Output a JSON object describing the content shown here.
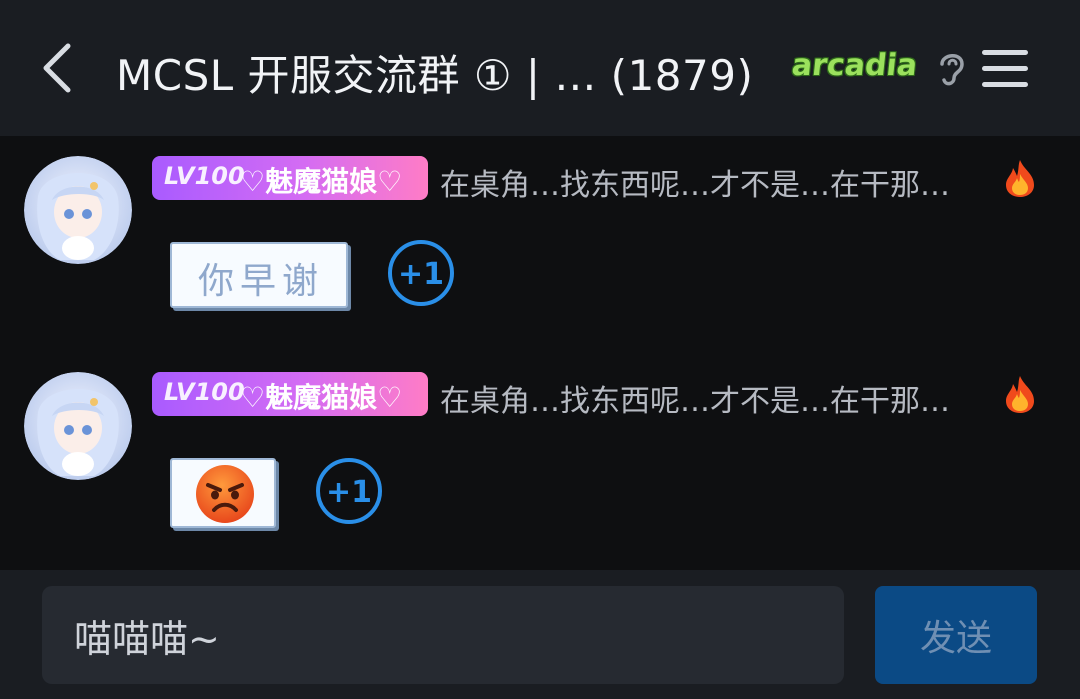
{
  "header": {
    "back_icon": "chevron-left-icon",
    "title": "MCSL 开服交流群 ① | …  (1879)",
    "badge_text": "arcadia",
    "ear_icon": "ear-icon",
    "menu_icon": "hamburger-menu-icon"
  },
  "messages": [
    {
      "level": "LV100",
      "nickname": "♡魅魔猫娘♡",
      "preview": "在桌角…找东西呢…才不是…在干那…",
      "fire_icon": "fire-icon",
      "sticker_text": "你早谢",
      "plus_one": "+1"
    },
    {
      "level": "LV100",
      "nickname": "♡魅魔猫娘♡",
      "preview": "在桌角…找东西呢…才不是…在干那…",
      "fire_icon": "fire-icon",
      "sticker_emoji": "angry-face-emoji",
      "plus_one": "+1"
    }
  ],
  "composer": {
    "input_value": "喵喵喵~",
    "send_label": "发送"
  },
  "colors": {
    "header_bg": "#1a1d22",
    "chat_bg": "#0e0f11",
    "accent_blue": "#2a8fe8",
    "send_button": "#0b4a85",
    "level_tag_start": "#a95bff",
    "level_tag_end": "#ff7cc6"
  }
}
